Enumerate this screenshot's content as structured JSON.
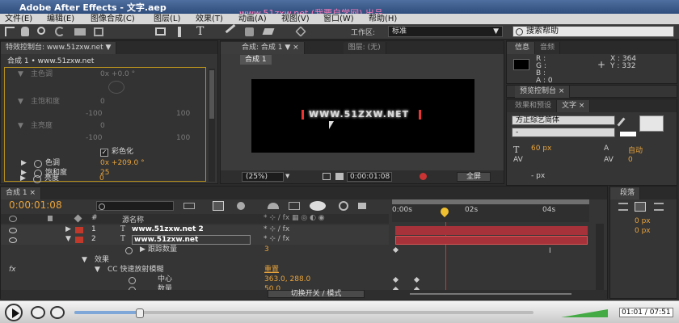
{
  "window": {
    "title": "Adobe After Effects - 文字.aep",
    "watermark": "www.51zxw.net (我要自学网) 出品"
  },
  "menu": [
    "文件(E)",
    "编辑(E)",
    "图像合成(C)",
    "图层(L)",
    "效果(T)",
    "动画(A)",
    "视图(V)",
    "窗口(W)",
    "帮助(H)"
  ],
  "toolbar": {
    "workspace_label": "工作区:",
    "workspace_value": "标准",
    "search_placeholder": "搜索帮助"
  },
  "effects_panel": {
    "tab": "特效控制台: www.51zxw.net",
    "subtitle": "合成 1 • www.51zxw.net",
    "rows": [
      {
        "label": "主色调",
        "value": "0x +0.0 °"
      },
      {
        "label": "主饱和度",
        "value": "0"
      },
      {
        "label": "",
        "value": "-100",
        "value2": "100"
      },
      {
        "label": "主亮度",
        "value": "0"
      },
      {
        "label": "",
        "value": "-100",
        "value2": "100"
      },
      {
        "label": "彩色化",
        "value": ""
      },
      {
        "label": "色调",
        "value": "0x +209.0 °"
      },
      {
        "label": "饱和度",
        "value": "25"
      },
      {
        "label": "亮度",
        "value": "0"
      }
    ]
  },
  "comp_panel": {
    "tab_comp": "合成: 合成 1",
    "tab_layer": "图层: (无)",
    "subtab": "合成 1",
    "comp_text": "WWW.51ZXW.NET",
    "zoom": "(25%)",
    "timecode": "0:00:01:08",
    "view": "全屏"
  },
  "info_panel": {
    "tab_info": "信息",
    "tab_audio": "音频",
    "r": "R :",
    "g": "G :",
    "b": "B :",
    "a": "A : 0",
    "x": "X : 364",
    "y": "Y : 332"
  },
  "preview_tab": "预览控制台",
  "char_panel": {
    "tab_effects": "效果和预设",
    "tab_char": "文字",
    "font": "方正综艺简体",
    "style": "-",
    "size": "60 px",
    "leading": "自动",
    "kerning": "0",
    "px": "- px"
  },
  "timeline": {
    "tab": "合成 1",
    "timecode": "0:00:01:08",
    "header_name": "源名称",
    "ruler": [
      "0:00s",
      "02s",
      "04s"
    ],
    "layers": [
      {
        "num": "1",
        "name": "www.51zxw.net 2"
      },
      {
        "num": "2",
        "name": "www.51zxw.net"
      }
    ],
    "sub_rows": [
      {
        "label": "跟踪数量",
        "value": "3"
      },
      {
        "label": "效果",
        "value": ""
      },
      {
        "label": "CC 快速放射模糊",
        "value": "重置"
      },
      {
        "label": "中心",
        "value": "363.0, 288.0"
      },
      {
        "label": "数量",
        "value": "50.0"
      }
    ],
    "toggle": "切换开关 / 模式"
  },
  "paragraph_panel": {
    "tab": "段落",
    "px1": "0 px",
    "px2": "0 px"
  },
  "player": {
    "time": "01:01 / 07:51",
    "progress": 0.14
  },
  "colors": {
    "accent_orange": "#e8a33b",
    "layer_red": "#c0392b",
    "bar_red": "#a8323a"
  }
}
